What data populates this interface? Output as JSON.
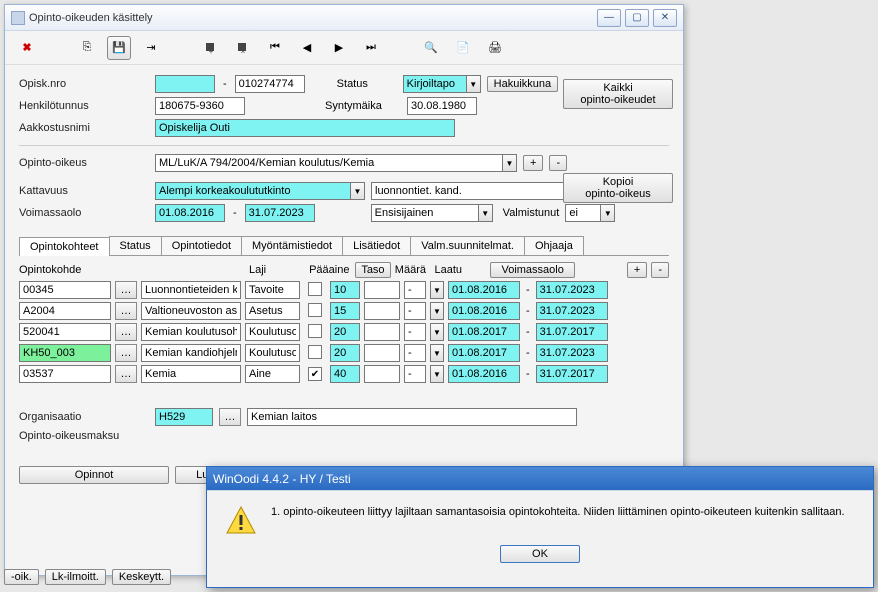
{
  "window": {
    "title": "Opinto-oikeuden käsittely"
  },
  "form": {
    "opisk_nro_label": "Opisk.nro",
    "opisk_nro_code": "010274774",
    "status_label": "Status",
    "status_value": "Kirjoiltapo",
    "hakuikkuna": "Hakuikkuna",
    "kaikki_btn1": "Kaikki",
    "kaikki_btn2": "opinto-oikeudet",
    "henkilotunnus_label": "Henkilötunnus",
    "henkilotunnus_value": "180675-9360",
    "syntymaika_label": "Syntymäika",
    "syntymaika_value": "30.08.1980",
    "aakkostusnimi_label": "Aakkostusnimi",
    "aakkostusnimi_value": "Opiskelija Outi",
    "opinto_oikeus_label": "Opinto-oikeus",
    "opinto_oikeus_value": "ML/LuK/A 794/2004/Kemian koulutus/Kemia",
    "kopioi_btn1": "Kopioi",
    "kopioi_btn2": "opinto-oikeus",
    "kattavuus_label": "Kattavuus",
    "kattavuus_value": "Alempi korkeakoulututkinto",
    "kattavuus_text": "luonnontiet. kand.",
    "voimassaolo_label": "Voimassaolo",
    "voimassaolo_start": "01.08.2016",
    "voimassaolo_end": "31.07.2023",
    "ensisijainen": "Ensisijainen",
    "valmistunut_label": "Valmistunut",
    "valmistunut_value": "ei"
  },
  "tabs": {
    "t0": "Opintokohteet",
    "t1": "Status",
    "t2": "Opintotiedot",
    "t3": "Myöntämistiedot",
    "t4": "Lisätiedot",
    "t5": "Valm.suunnitelmat.",
    "t6": "Ohjaaja"
  },
  "headers": {
    "opintokohde": "Opintokohde",
    "laji": "Laji",
    "paaaine": "Pääaine",
    "taso": "Taso",
    "maara": "Määrä",
    "laatu": "Laatu",
    "voimassaolo": "Voimassaolo"
  },
  "rows": [
    {
      "code": "00345",
      "name": "Luonnontieteiden ka",
      "laji": "Tavoite",
      "paaaine": false,
      "taso": "10",
      "maara": "",
      "laatu": "-",
      "v1": "01.08.2016",
      "v2": "31.07.2023"
    },
    {
      "code": "A2004",
      "name": "Valtioneuvoston ase",
      "laji": "Asetus",
      "paaaine": false,
      "taso": "15",
      "maara": "",
      "laatu": "-",
      "v1": "01.08.2016",
      "v2": "31.07.2023"
    },
    {
      "code": "520041",
      "name": "Kemian koulutusohj",
      "laji": "Koulutusoh",
      "paaaine": false,
      "taso": "20",
      "maara": "",
      "laatu": "-",
      "v1": "01.08.2017",
      "v2": "31.07.2017"
    },
    {
      "code": "KH50_003",
      "name": "Kemian kandiohjelm",
      "laji": "Koulutusoh",
      "paaaine": false,
      "taso": "20",
      "maara": "",
      "laatu": "-",
      "v1": "01.08.2017",
      "v2": "31.07.2023"
    },
    {
      "code": "03537",
      "name": "Kemia",
      "laji": "Aine",
      "paaaine": true,
      "taso": "40",
      "maara": "",
      "laatu": "-",
      "v1": "01.08.2016",
      "v2": "31.07.2017"
    }
  ],
  "org": {
    "label": "Organisaatio",
    "code": "H529",
    "name": "Kemian laitos",
    "maksu_label": "Opinto-oikeusmaksu"
  },
  "buttons": {
    "opinnot": "Opinnot",
    "luk": "Luk"
  },
  "bottom": {
    "oik": "-oik.",
    "lk": "Lk-ilmoitt.",
    "keskeytt": "Keskeytt."
  },
  "modal": {
    "title": "WinOodi 4.4.2  -  HY / Testi",
    "message": "1. opinto-oikeuteen liittyy lajiltaan samantasoisia opintokohteita. Niiden liittäminen opinto-oikeuteen kuitenkin sallitaan.",
    "ok": "OK"
  },
  "dash": "-",
  "plus": "+",
  "minus": "-"
}
